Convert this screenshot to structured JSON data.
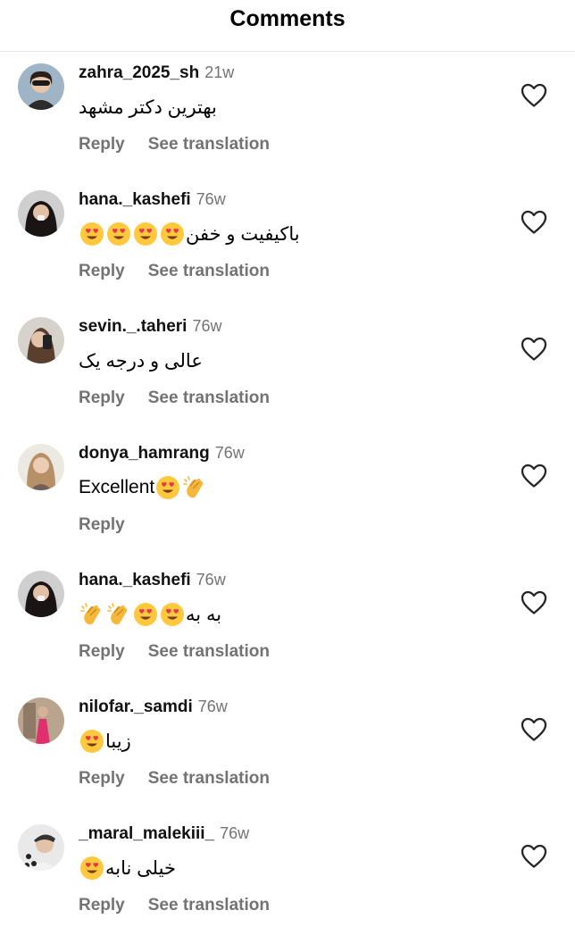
{
  "header": {
    "title": "Comments"
  },
  "labels": {
    "reply": "Reply",
    "see_translation": "See translation"
  },
  "colors": {
    "secondary_text": "#737373",
    "emoji_face": "#FFC83D",
    "heart_eyes": "#E8364A",
    "clap": "#F5B83A"
  },
  "comments": [
    {
      "username": "zahra_2025_sh",
      "time": "21w",
      "text": "بهترین دکتر مشهد",
      "emojis": [],
      "emoji_side": "left",
      "see_translation": true,
      "avatar_icon": "avatar-woman-sunglasses"
    },
    {
      "username": "hana._kashefi",
      "time": "76w",
      "text": "باکیفیت  و خفن",
      "emojis": [
        "heart-eyes",
        "heart-eyes",
        "heart-eyes",
        "heart-eyes"
      ],
      "emoji_side": "left",
      "see_translation": true,
      "avatar_icon": "avatar-woman-dark-hair"
    },
    {
      "username": "sevin._.taheri",
      "time": "76w",
      "text": "عالی و درجه یک",
      "emojis": [],
      "emoji_side": "left",
      "see_translation": true,
      "avatar_icon": "avatar-selfie"
    },
    {
      "username": "donya_hamrang",
      "time": "76w",
      "text": "Excellent",
      "emojis": [
        "heart-eyes",
        "clapping-hands"
      ],
      "emoji_side": "right",
      "see_translation": false,
      "avatar_icon": "avatar-woman-blonde"
    },
    {
      "username": "hana._kashefi",
      "time": "76w",
      "text": "به به",
      "emojis": [
        "clapping-hands",
        "clapping-hands",
        "heart-eyes",
        "heart-eyes"
      ],
      "emoji_side": "left",
      "see_translation": true,
      "avatar_icon": "avatar-woman-dark-hair"
    },
    {
      "username": "nilofar._samdi",
      "time": "76w",
      "text": "زیبا",
      "emojis": [
        "heart-eyes"
      ],
      "emoji_side": "left",
      "see_translation": true,
      "avatar_icon": "avatar-pink-dress"
    },
    {
      "username": "_maral_malekiii_",
      "time": "76w",
      "text": "خیلی نابه",
      "emojis": [
        "heart-eyes"
      ],
      "emoji_side": "left",
      "see_translation": true,
      "avatar_icon": "avatar-woman-cap"
    }
  ]
}
